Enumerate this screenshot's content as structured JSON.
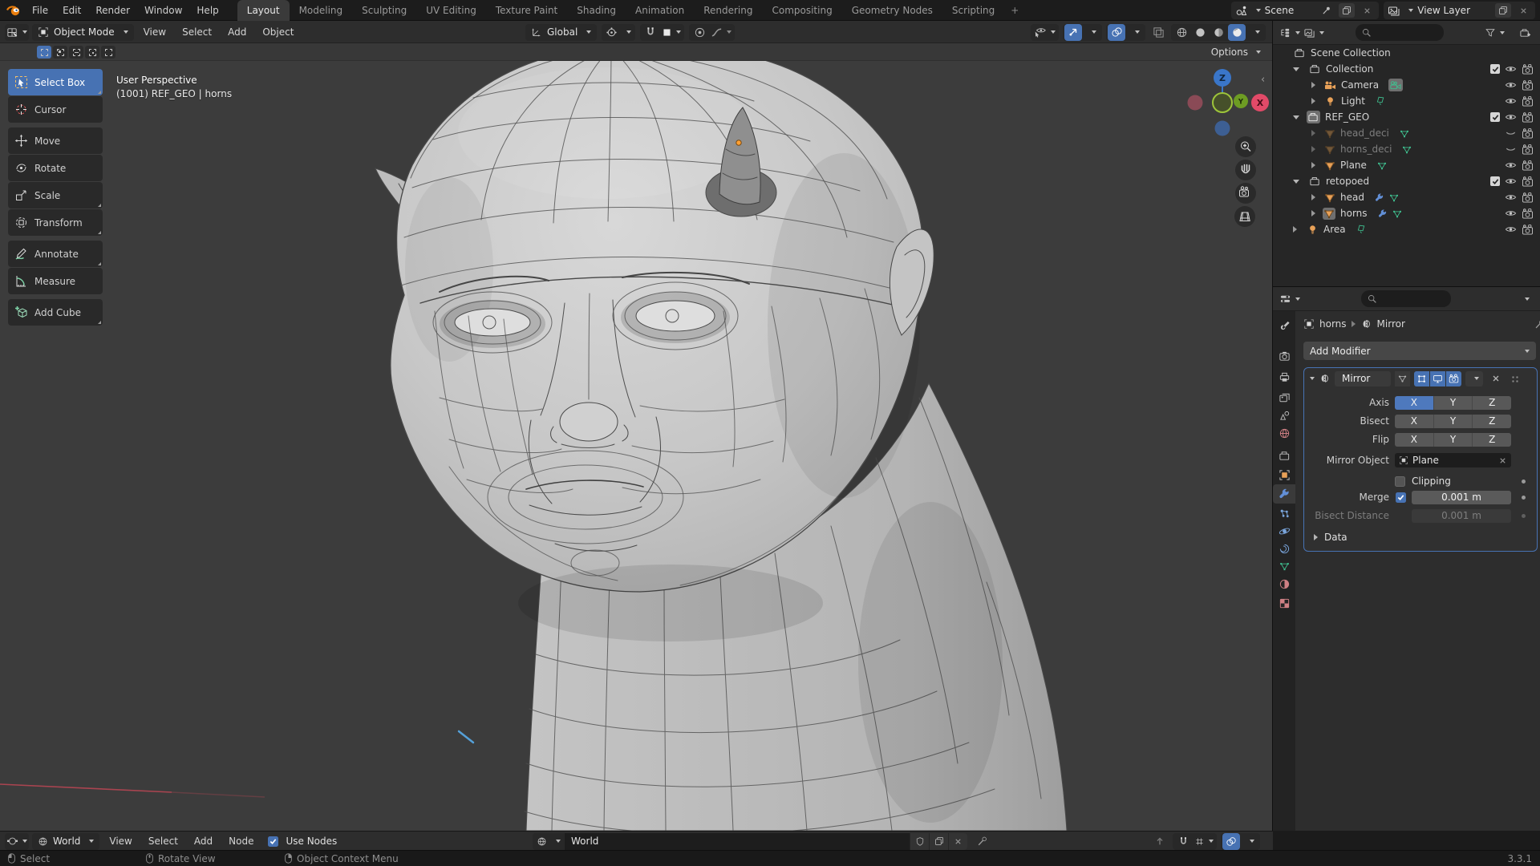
{
  "topbar": {
    "menus": [
      "File",
      "Edit",
      "Render",
      "Window",
      "Help"
    ],
    "tabs": [
      "Layout",
      "Modeling",
      "Sculpting",
      "UV Editing",
      "Texture Paint",
      "Shading",
      "Animation",
      "Rendering",
      "Compositing",
      "Geometry Nodes",
      "Scripting"
    ],
    "active_tab": "Layout",
    "add_tab_label": "+",
    "scene_name": "Scene",
    "view_layer_name": "View Layer"
  },
  "viewport": {
    "header": {
      "mode": "Object Mode",
      "menus": [
        "View",
        "Select",
        "Add",
        "Object"
      ],
      "orientation": "Global"
    },
    "tool_header": {
      "options_label": "Options"
    },
    "overlay": {
      "view_label": "User Perspective",
      "object_label": "(1001) REF_GEO | horns"
    },
    "toolbar": [
      "Select Box",
      "Cursor",
      "Move",
      "Rotate",
      "Scale",
      "Transform",
      "Annotate",
      "Measure",
      "Add Cube"
    ],
    "active_tool": "Select Box",
    "gizmo": {
      "x": "X",
      "y": "Y",
      "z": "Z"
    }
  },
  "outliner": {
    "rows": [
      {
        "label": "Scene Collection"
      },
      {
        "label": "Collection"
      },
      {
        "label": "Camera"
      },
      {
        "label": "Light"
      },
      {
        "label": "REF_GEO"
      },
      {
        "label": "head_deci",
        "hidden": true
      },
      {
        "label": "horns_deci",
        "hidden": true
      },
      {
        "label": "Plane"
      },
      {
        "label": "retopoed"
      },
      {
        "label": "head"
      },
      {
        "label": "horns",
        "active": true
      },
      {
        "label": "Area"
      }
    ]
  },
  "properties": {
    "breadcrumb": {
      "object": "horns",
      "modifier": "Mirror"
    },
    "add_modifier_label": "Add Modifier",
    "modifier": {
      "name": "Mirror",
      "axis_label": "Axis",
      "bisect_label": "Bisect",
      "flip_label": "Flip",
      "axes": [
        "X",
        "Y",
        "Z"
      ],
      "active_axis": "X",
      "mirror_object_label": "Mirror Object",
      "mirror_object_value": "Plane",
      "clipping_label": "Clipping",
      "merge_label": "Merge",
      "merge_value": "0.001 m",
      "bisect_distance_label": "Bisect Distance",
      "bisect_distance_value": "0.001 m",
      "data_label": "Data"
    }
  },
  "bottom_bar": {
    "shader_type": "World",
    "menus": [
      "View",
      "Select",
      "Add",
      "Node"
    ],
    "use_nodes_label": "Use Nodes",
    "world_name": "World"
  },
  "status_bar": {
    "hints": [
      "Select",
      "Rotate View",
      "Object Context Menu"
    ],
    "version": "3.3.1"
  },
  "icons": {
    "search": "magnifier",
    "filter": "funnel",
    "pin": "pushpin",
    "close": "x-cross",
    "eye_open": "eye",
    "eye_closed": "closed-eye",
    "render_visibility": "camera",
    "checkbox_checked": "check"
  }
}
